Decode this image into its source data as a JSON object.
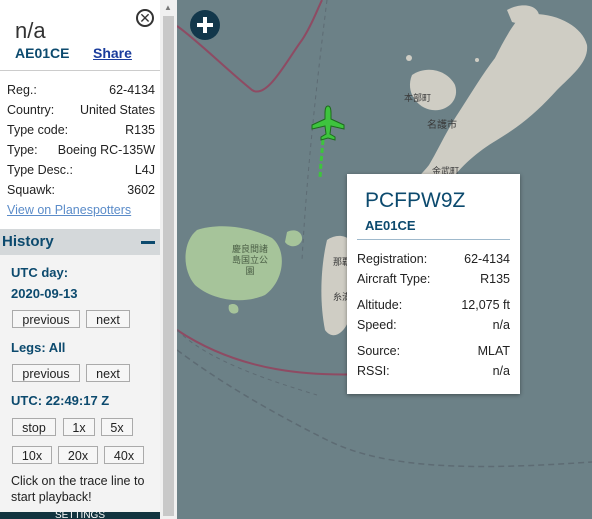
{
  "sidebar": {
    "callsign": "n/a",
    "hex": "AE01CE",
    "share_label": "Share",
    "info": [
      {
        "label": "Reg.:",
        "value": "62-4134"
      },
      {
        "label": "Country:",
        "value": "United States"
      },
      {
        "label": "Type code:",
        "value": "R135"
      },
      {
        "label": "Type:",
        "value": "Boeing RC-135W"
      },
      {
        "label": "Type Desc.:",
        "value": "L4J"
      },
      {
        "label": "Squawk:",
        "value": "3602"
      }
    ],
    "planespotters_link": "View on Planespotters",
    "history": {
      "title": "History",
      "utc_day_label": "UTC day:",
      "utc_day_value": "2020-09-13",
      "previous": "previous",
      "next": "next",
      "legs_label": "Legs: All",
      "utc_time": "UTC: 22:49:17 Z",
      "stop": "stop",
      "speeds": [
        "1x",
        "5x",
        "10x",
        "20x",
        "40x"
      ],
      "help_text": "Click on the trace line to start playback!",
      "bottom_label": "SETTINGS"
    }
  },
  "popup": {
    "callsign": "PCFPW9Z",
    "hex": "AE01CE",
    "rows": [
      {
        "label": "Registration:",
        "value": "62-4134"
      },
      {
        "label": "Aircraft Type:",
        "value": "R135"
      },
      {
        "label": "Altitude:",
        "value": "12,075 ft"
      },
      {
        "label": "Speed:",
        "value": "n/a"
      },
      {
        "label": "Source:",
        "value": "MLAT"
      },
      {
        "label": "RSSI:",
        "value": "n/a"
      }
    ]
  },
  "map": {
    "labels": [
      "本部町",
      "名護市",
      "金武町",
      "那覇",
      "慶良間諸島国立公園",
      "糸満"
    ]
  },
  "colors": {
    "accent": "#0c4a6e",
    "sea": "#6c8187",
    "land": "#cfcdc4",
    "aircraft": "#3ec43e",
    "forest": "#a6c49a"
  },
  "icons": {
    "close": "close-icon",
    "zoom": "plus-icon",
    "aircraft": "airplane-icon"
  }
}
